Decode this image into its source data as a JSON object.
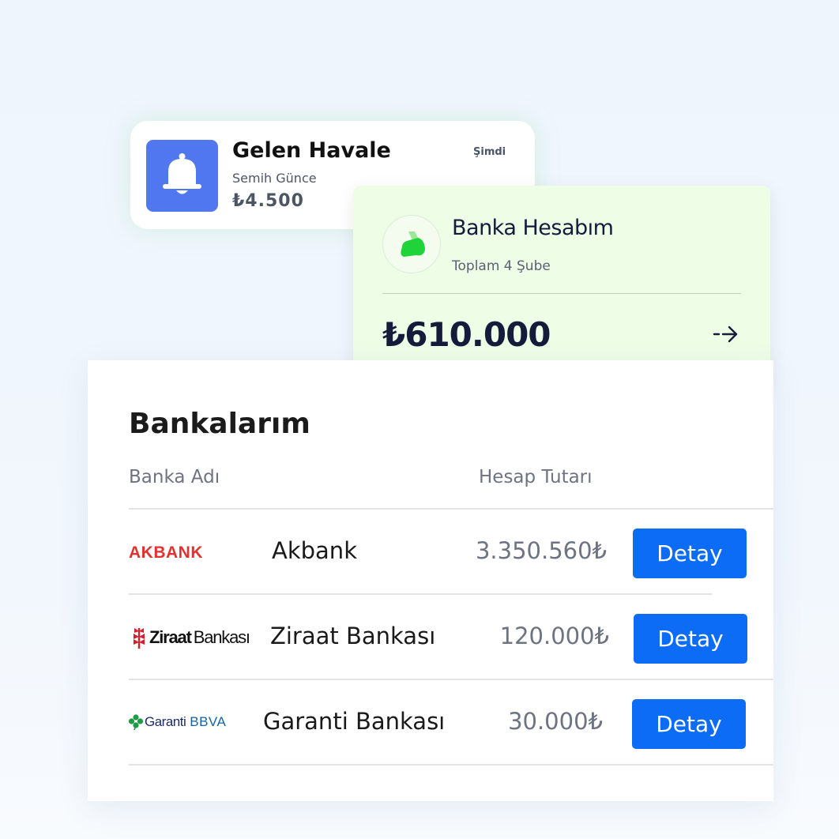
{
  "notification": {
    "title": "Gelen Havale",
    "sender": "Semih Günce",
    "amount": "₺4.500",
    "time": "Şimdi",
    "icon": "bell-icon",
    "icon_bg": "#5077f0"
  },
  "account": {
    "name": "Banka Hesabım",
    "branches": "Toplam 4 Şube",
    "total": "₺610.000",
    "icon": "app-logo-icon",
    "arrow_icon": "arrow-right-icon",
    "bg": "#eefde6"
  },
  "banks": {
    "title": "Bankalarım",
    "columns": {
      "name": "Banka Adı",
      "amount": "Hesap Tutarı"
    },
    "rows": [
      {
        "logo_text": "AKBANK",
        "name": "Akbank",
        "amount": "3.350.560₺",
        "button": "Detay"
      },
      {
        "logo_text_bold": "Ziraat",
        "logo_text": "Bankası",
        "name": "Ziraat Bankası",
        "amount": "120.000₺",
        "button": "Detay"
      },
      {
        "logo_text": "Garanti",
        "logo_text_2": "BBVA",
        "name": "Garanti Bankası",
        "amount": "30.000₺",
        "button": "Detay"
      }
    ],
    "button_color": "#0c6cf6"
  }
}
